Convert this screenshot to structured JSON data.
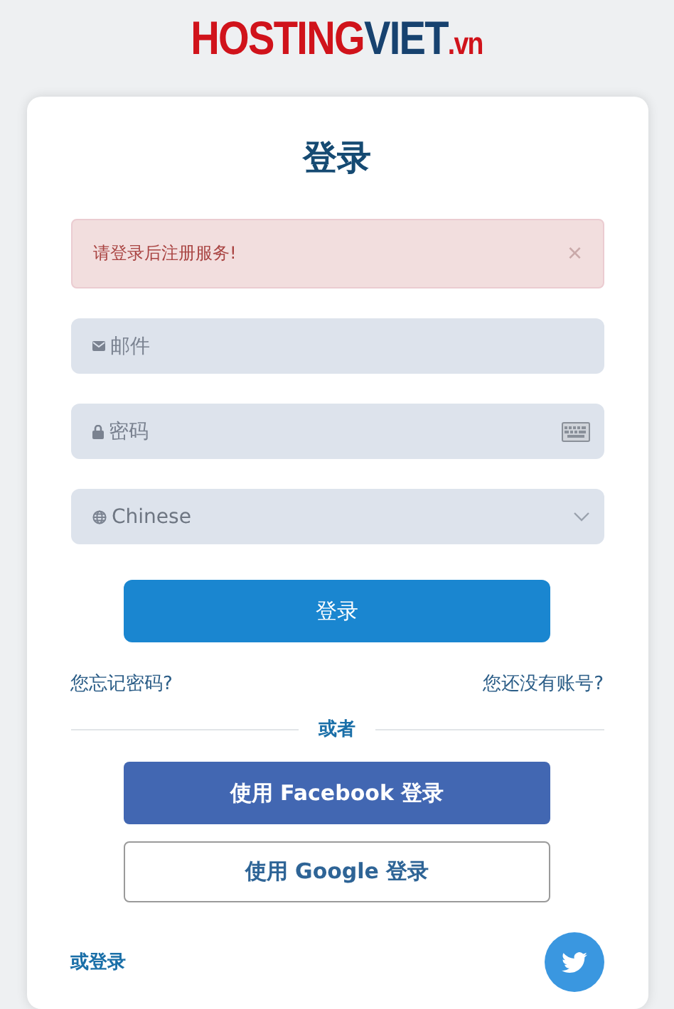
{
  "logo": {
    "parts": [
      "HOSTING",
      "VIET",
      ".vn"
    ]
  },
  "title": "登录",
  "alert": {
    "message": "请登录后注册服务!",
    "close": "×"
  },
  "email": {
    "placeholder": "邮件"
  },
  "password": {
    "placeholder": "密码"
  },
  "language": {
    "value": "Chinese"
  },
  "login_button": "登录",
  "forgot_link": "您忘记密码?",
  "register_link": "您还没有账号?",
  "divider": "或者",
  "social_buttons": [
    {
      "kind": "facebook",
      "label": "使用 Facebook 登录"
    },
    {
      "kind": "google",
      "label": "使用 Google 登录"
    }
  ],
  "or_login": "或登录"
}
